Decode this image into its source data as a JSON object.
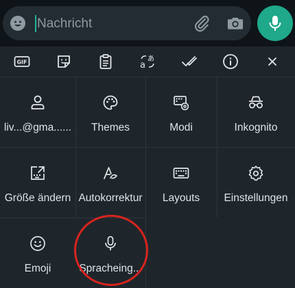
{
  "input": {
    "placeholder": "Nachricht"
  },
  "toolbar": {
    "gif_label": "GIF"
  },
  "grid": {
    "items": [
      {
        "label": "liv...@gma......"
      },
      {
        "label": "Themes"
      },
      {
        "label": "Modi"
      },
      {
        "label": "Inkognito"
      },
      {
        "label": "Größe ändern"
      },
      {
        "label": "Autokorrektur"
      },
      {
        "label": "Layouts"
      },
      {
        "label": "Einstellungen"
      },
      {
        "label": "Emoji"
      },
      {
        "label": "Spracheing..."
      }
    ]
  },
  "colors": {
    "accent": "#1fa88a",
    "highlight_circle": "#d8241f",
    "background": "#1f262b"
  }
}
